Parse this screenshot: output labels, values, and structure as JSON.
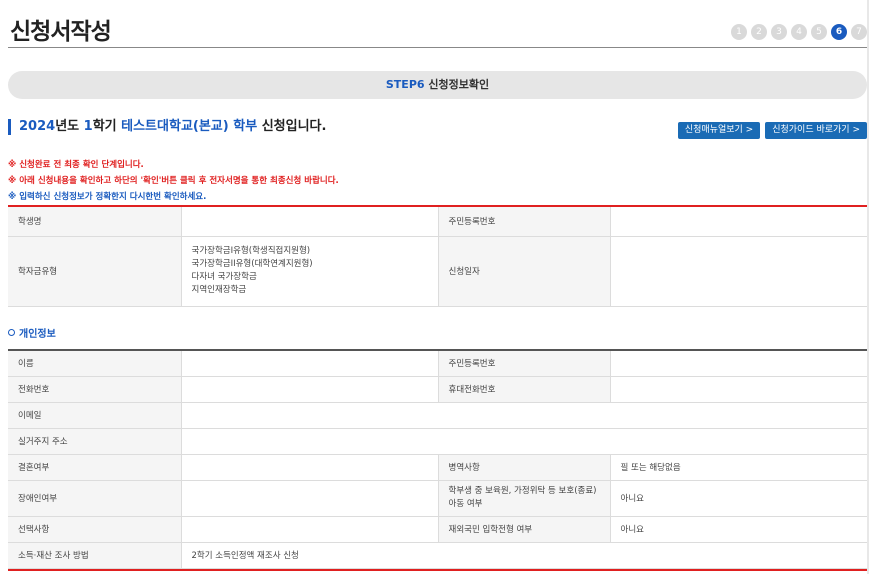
{
  "header": {
    "title": "신청서작성",
    "steps": [
      "1",
      "2",
      "3",
      "4",
      "5",
      "6",
      "7"
    ],
    "active_step": "6"
  },
  "step_bar": {
    "step_label": "STEP6",
    "text": "신청정보확인"
  },
  "headline": {
    "year": "2024",
    "year_suffix": "년도",
    "semester": "1",
    "semester_suffix": "학기",
    "school": "테스트대학교(본교)",
    "level": "학부",
    "tail": "신청입니다."
  },
  "buttons": {
    "manual": "신청매뉴얼보기 >",
    "guide": "신청가이드 바로가기 >"
  },
  "notices": [
    "※ 신청완료 전 최종 확인 단계입니다.",
    "※ 아래 신청내용을 확인하고 하단의 '확인'버튼 클릭 후 전자서명을 통한 최종신청 바랍니다.",
    "※ 입력하신 신청정보가 정확한지 다시한번 확인하세요."
  ],
  "summary": {
    "student_name_label": "학생명",
    "student_name_value": "",
    "rrn_label": "주민등록번호",
    "rrn_value": "",
    "scholarship_type_label": "학자금유형",
    "scholarship_types": [
      "국가장학금I유형(학생직접지원형)",
      "국가장학금II유형(대학연계지원형)",
      "다자녀 국가장학금",
      "지역인재장학금"
    ],
    "apply_date_label": "신청일자",
    "apply_date_value": ""
  },
  "personal_section": {
    "title": "개인정보",
    "name_label": "이름",
    "name_value": "",
    "rrn_label": "주민등록번호",
    "rrn_value": "",
    "phone_label": "전화번호",
    "phone_value": "",
    "mobile_label": "휴대전화번호",
    "mobile_value": "",
    "email_label": "이메일",
    "email_value": "",
    "address_label": "실거주지 주소",
    "address_value": "",
    "married_label": "결혼여부",
    "married_value": "",
    "military_label": "병역사항",
    "military_value": "필 또는 해당없음",
    "disabled_label": "장애인여부",
    "disabled_value": "",
    "child_care_label": "학부생 중 보육원, 가정위탁 등 보호(종료)아동 여부",
    "child_care_value": "아니요",
    "optional_label": "선택사항",
    "optional_value": "",
    "overseas_label": "재외국민 입학전형 여부",
    "overseas_value": "아니요",
    "income_label": "소득·재산 조사 방법",
    "income_value": "2학기 소득인정액 재조사 신청"
  }
}
